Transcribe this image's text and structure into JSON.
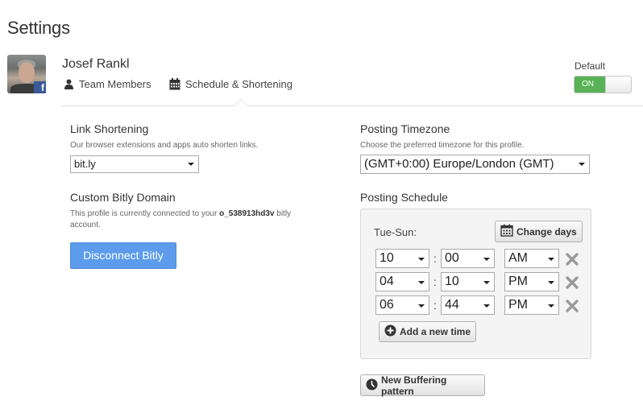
{
  "page": {
    "title": "Settings"
  },
  "profile": {
    "name": "Josef Rankl",
    "network_badge": "f",
    "tabs": [
      {
        "label": "Team Members",
        "icon": "user-icon"
      },
      {
        "label": "Schedule & Shortening",
        "icon": "calendar-icon"
      }
    ],
    "default": {
      "label": "Default",
      "toggle_state": "ON"
    }
  },
  "link_shortening": {
    "title": "Link Shortening",
    "description": "Our browser extensions and apps auto shorten links.",
    "selected": "bit.ly"
  },
  "bitly_domain": {
    "title": "Custom Bitly Domain",
    "description_before": "This profile is currently connected to your ",
    "account_name": "o_538913hd3v",
    "description_after": " bitly",
    "description_line2": "account.",
    "disconnect_label": "Disconnect Bitly"
  },
  "timezone": {
    "title": "Posting Timezone",
    "description": "Choose the preferred timezone for this profile.",
    "selected": "(GMT+0:00) Europe/London (GMT)"
  },
  "schedule": {
    "title": "Posting Schedule",
    "days_label": "Tue-Sun:",
    "change_days_label": "Change days",
    "separator": ":",
    "times": [
      {
        "hour": "10",
        "minute": "00",
        "period": "AM"
      },
      {
        "hour": "04",
        "minute": "10",
        "period": "PM"
      },
      {
        "hour": "06",
        "minute": "44",
        "period": "PM"
      }
    ],
    "add_time_label": "Add a new time"
  },
  "new_pattern_label": "New Buffering pattern",
  "colors": {
    "accent_blue": "#5d9cec",
    "toggle_green": "#59b255",
    "facebook_blue": "#3b5998"
  }
}
